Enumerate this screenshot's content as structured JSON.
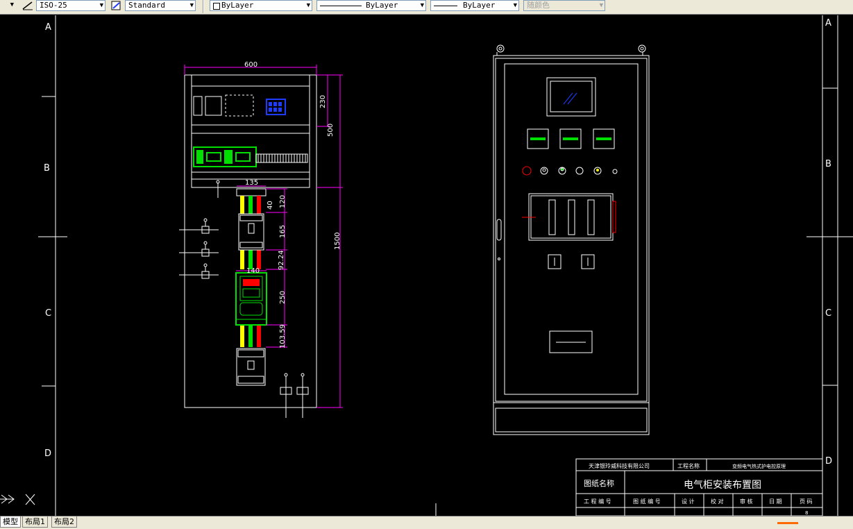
{
  "toolbar": {
    "dimstyle": "ISO-25",
    "textstyle": "Standard",
    "layer": "ByLayer",
    "linetype": "ByLayer",
    "lineweight": "ByLayer",
    "color": "随颜色"
  },
  "border": {
    "rows_left": [
      "A",
      "B",
      "C",
      "D"
    ],
    "rows_right": [
      "A",
      "B",
      "C",
      "D"
    ]
  },
  "dimensions": {
    "width_top": "600",
    "right_230": "230",
    "right_500": "500",
    "right_1500": "1500",
    "w_135": "135",
    "h_120": "120",
    "h_40": "40",
    "h_165": "165",
    "h_92": "92.24",
    "w_140": "140",
    "h_250": "250",
    "h_103": "103.59"
  },
  "title_block": {
    "company": "天津银玲威科技有限公司",
    "project_label": "工程名称",
    "project_name": "变频电气热式护电控原理",
    "drawing_name_label": "图纸名称",
    "drawing_name": "电气柜安装布置图",
    "cols": [
      "工 程 编 号",
      "图 纸 编 号",
      "设 计",
      "校 对",
      "审 核",
      "日 期",
      "页 码"
    ],
    "page_no": "8"
  },
  "tabs": {
    "model": "模型",
    "layout1": "布局1",
    "layout2": "布局2"
  },
  "colors": {
    "green": "#00e000",
    "yellow": "#ffff00",
    "red": "#ff0000",
    "magenta": "#ff00ff",
    "blue": "#1e3cff"
  }
}
